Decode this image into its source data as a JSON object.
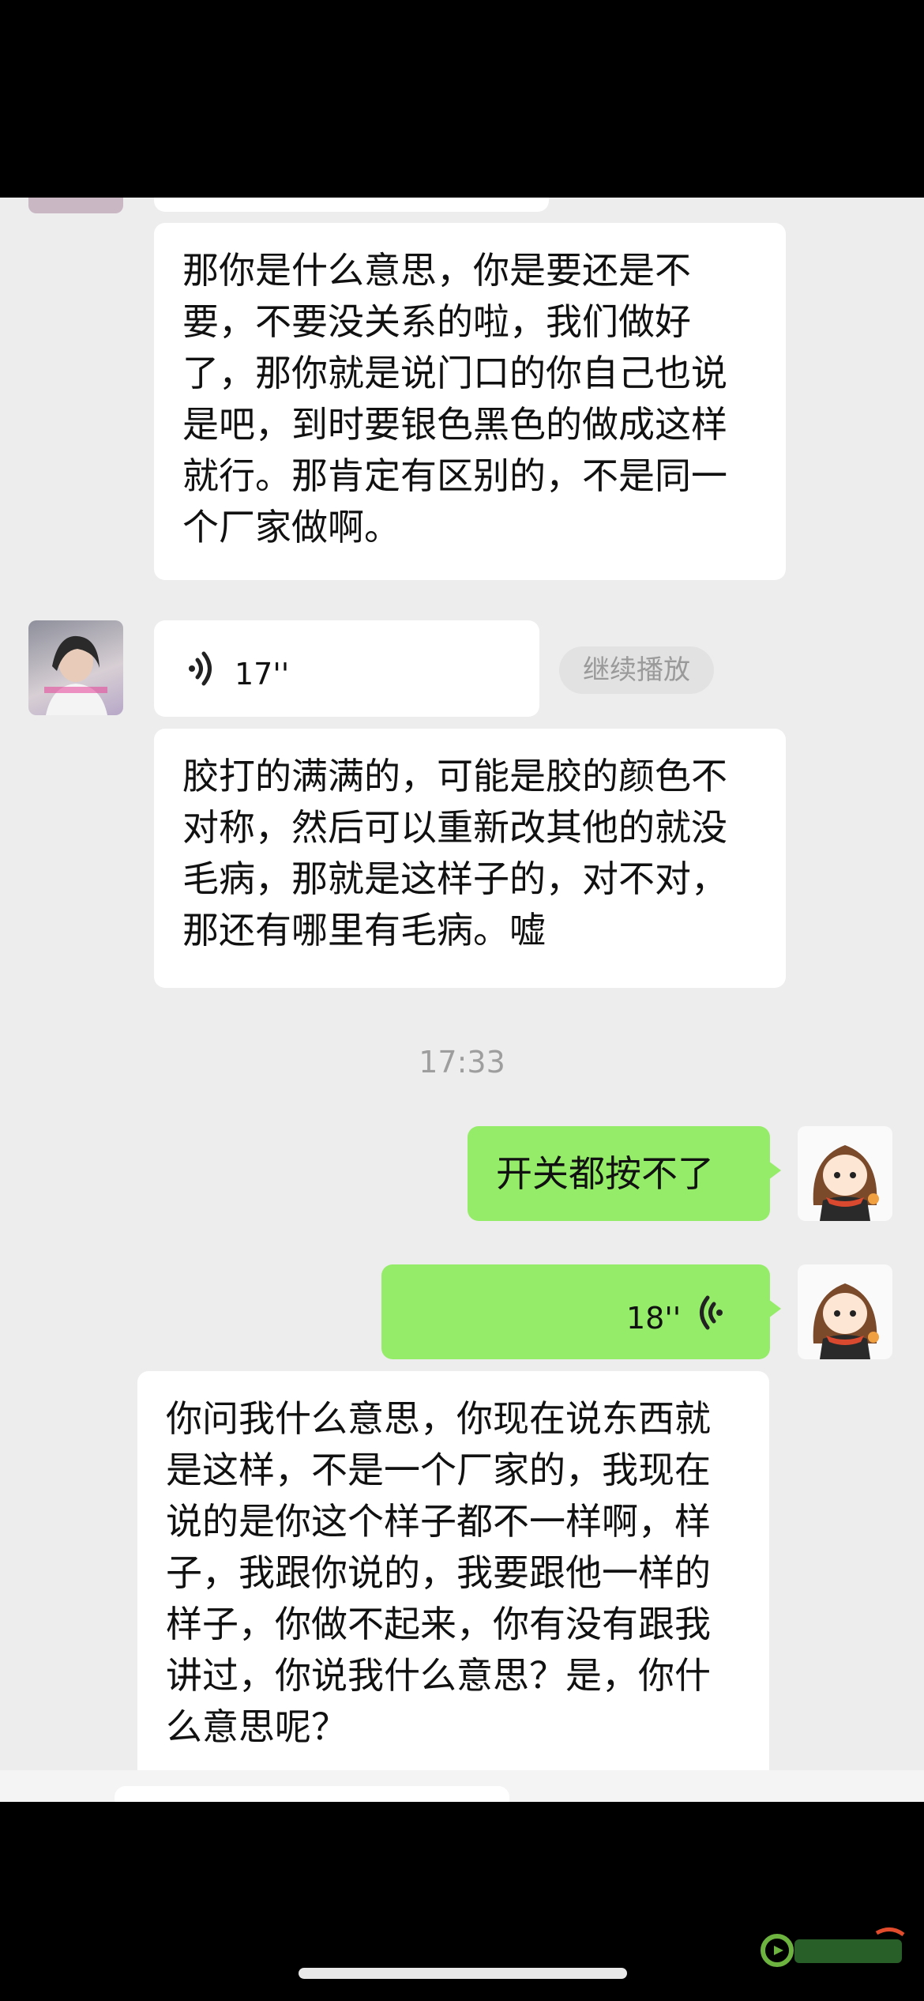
{
  "messages": {
    "m1_text": "那你是什么意思，你是要还是不要，不要没关系的啦，我们做好了，那你就是说门口的你自己也说是吧，到时要银色黑色的做成这样就行。那肯定有区别的，不是同一个厂家做啊。",
    "voice1_duration": "17''",
    "continue_play": "继续播放",
    "m2_text": "胶打的满满的，可能是胶的颜色不对称，然后可以重新改其他的就没毛病，那就是这样子的，对不对，那还有哪里有毛病。嘘",
    "time_1": "17:33",
    "m3_text": "开关都按不了",
    "voice2_duration": "18''",
    "m4_text": "你问我什么意思，你现在说东西就是这样，不是一个厂家的，我现在说的是你这个样子都不一样啊，样子，我跟你说的，我要跟他一样的样子，你做不起来，你有没有跟我讲过，你说我什么意思？是，你什么意思呢？"
  },
  "colors": {
    "chat_bg": "#ededed",
    "sent_bubble": "#95ec69",
    "received_bubble": "#ffffff"
  },
  "icons": {
    "voice_in": "voice-wave-icon",
    "voice_out": "voice-wave-icon",
    "watermark": "lgbbs-logo"
  }
}
